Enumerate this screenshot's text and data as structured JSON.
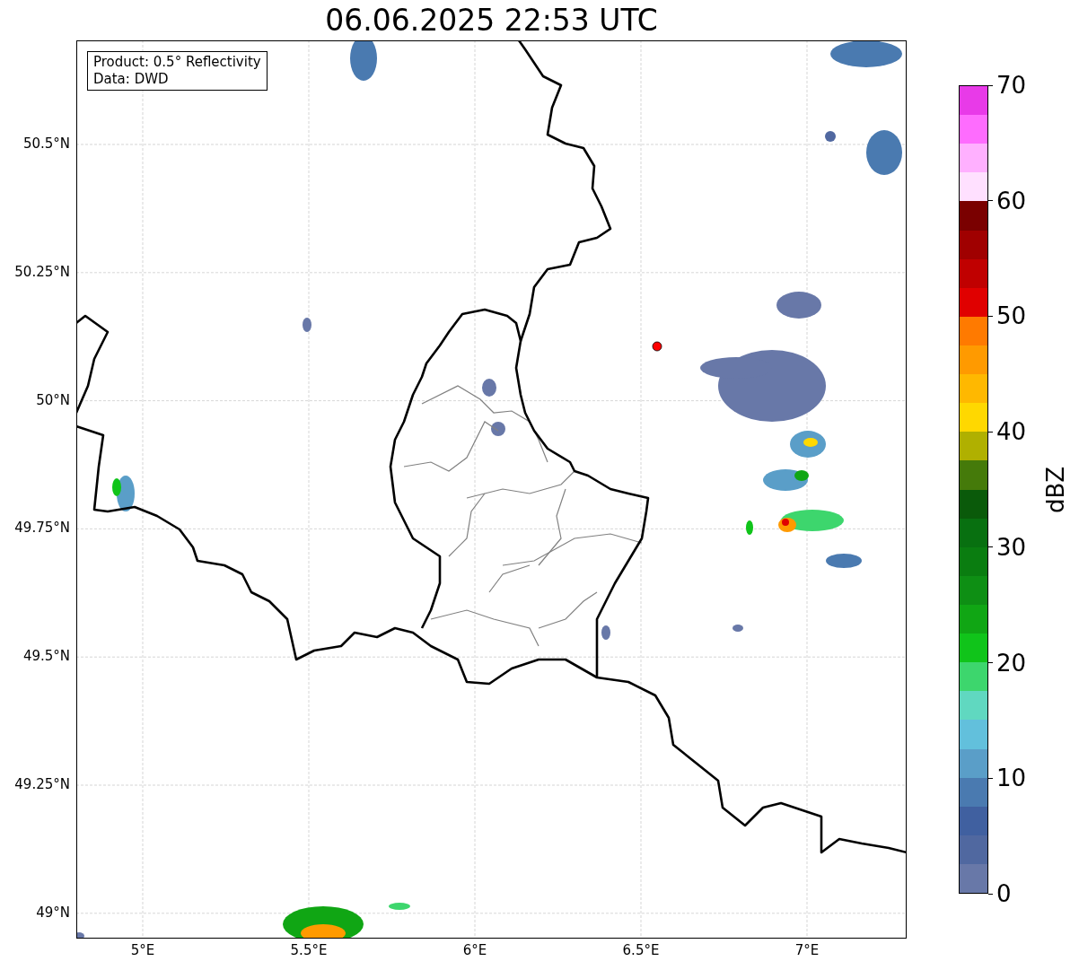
{
  "title": "06.06.2025 22:53 UTC",
  "info_box": [
    "Product: 0.5° Reflectivity",
    "Data: DWD"
  ],
  "x_ticks": [
    "5°E",
    "5.5°E",
    "6°E",
    "6.5°E",
    "7°E"
  ],
  "y_ticks": [
    "50.5°N",
    "50.25°N",
    "50°N",
    "49.75°N",
    "49.5°N",
    "49.25°N",
    "49°N"
  ],
  "colorbar": {
    "label": "dBZ",
    "ticks": [
      "70",
      "60",
      "50",
      "40",
      "30",
      "20",
      "10",
      "0"
    ],
    "segments": [
      {
        "color": "#e83ae8"
      },
      {
        "color": "#fe6cfe"
      },
      {
        "color": "#ffb0ff"
      },
      {
        "color": "#ffe0ff"
      },
      {
        "color": "#7a0000"
      },
      {
        "color": "#a00000"
      },
      {
        "color": "#c00000"
      },
      {
        "color": "#e00000"
      },
      {
        "color": "#ff7a00"
      },
      {
        "color": "#ff9a00"
      },
      {
        "color": "#ffb800"
      },
      {
        "color": "#ffd800"
      },
      {
        "color": "#b0b000"
      },
      {
        "color": "#457a0a"
      },
      {
        "color": "#0a5a0a"
      },
      {
        "color": "#087010"
      },
      {
        "color": "#0a7d10"
      },
      {
        "color": "#0e8f14"
      },
      {
        "color": "#10a614"
      },
      {
        "color": "#10c41a"
      },
      {
        "color": "#3dd66d"
      },
      {
        "color": "#60d8c0"
      },
      {
        "color": "#62c0dc"
      },
      {
        "color": "#5a9ec8"
      },
      {
        "color": "#4a7ab0"
      },
      {
        "color": "#4060a0"
      },
      {
        "color": "#5068a0"
      },
      {
        "color": "#6878a8"
      }
    ]
  }
}
